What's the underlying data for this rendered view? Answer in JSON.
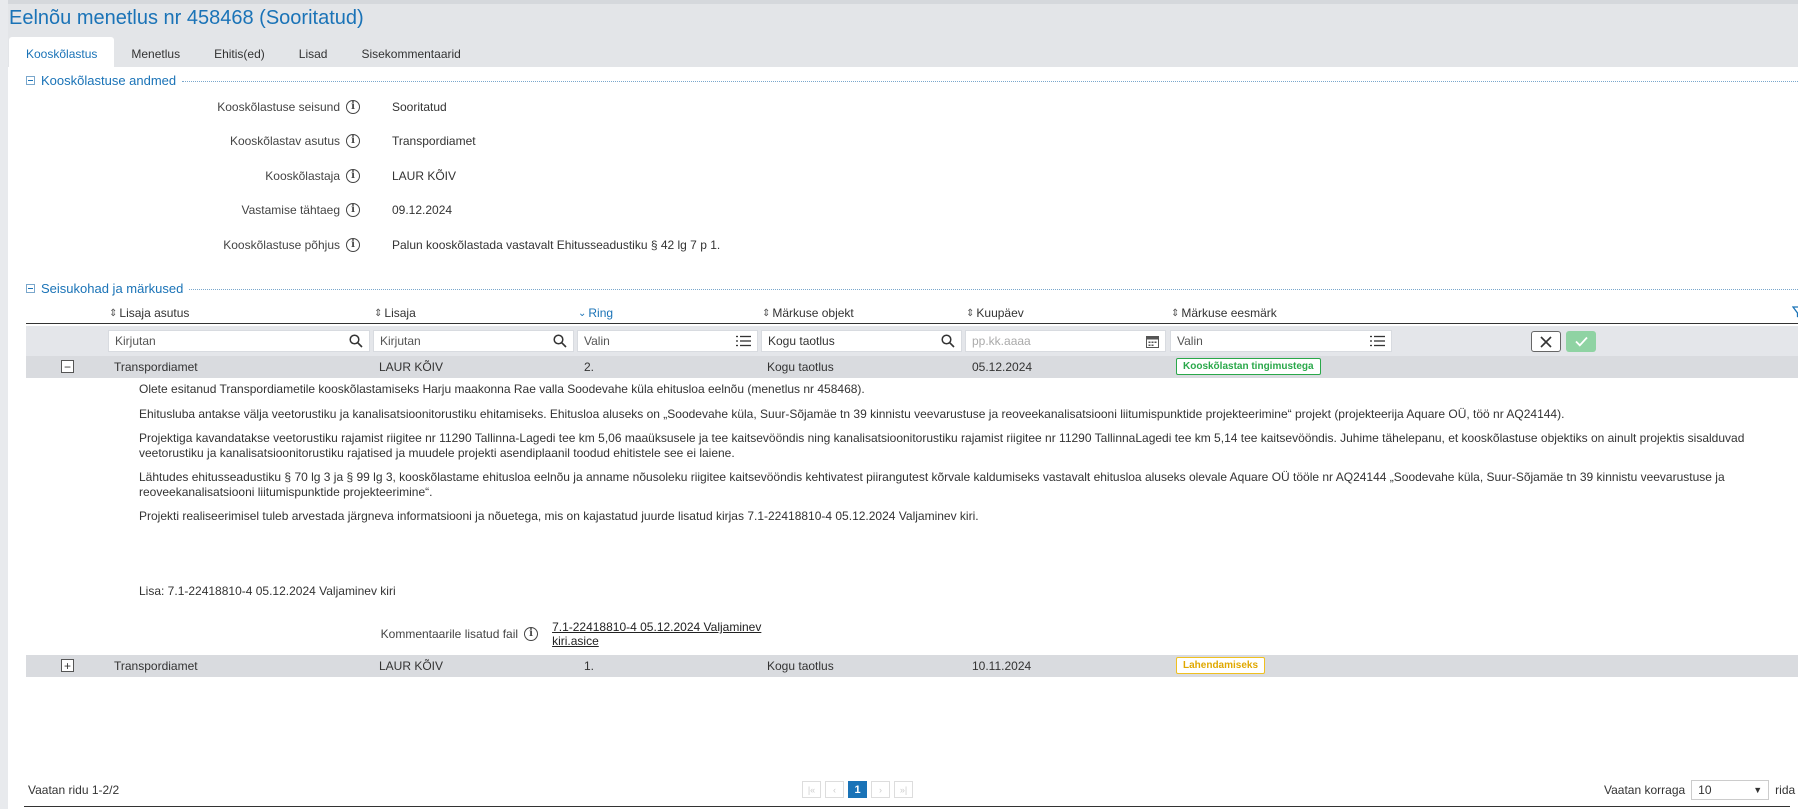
{
  "header": {
    "title": "Eelnõu menetlus nr 458468 (Sooritatud)",
    "tabs": [
      "Kooskõlastus",
      "Menetlus",
      "Ehitis(ed)",
      "Lisad",
      "Sisekommentaarid"
    ]
  },
  "section1": {
    "title": "Kooskõlastuse andmed",
    "fields": [
      {
        "label": "Kooskõlastuse seisund",
        "value": "Sooritatud"
      },
      {
        "label": "Kooskõlastav asutus",
        "value": "Transpordiamet"
      },
      {
        "label": "Kooskõlastaja",
        "value": "LAUR KÕIV"
      },
      {
        "label": "Vastamise tähtaeg",
        "value": "09.12.2024"
      },
      {
        "label": "Kooskõlastuse põhjus",
        "value": "Palun kooskõlastada vastavalt Ehitusseadustiku § 42 lg 7 p 1."
      }
    ]
  },
  "section2": {
    "title": "Seisukohad ja märkused",
    "columns": [
      "Lisaja asutus",
      "Lisaja",
      "Ring",
      "Märkuse objekt",
      "Kuupäev",
      "Märkuse eesmärk"
    ],
    "filters": {
      "asutus": "Kirjutan",
      "lisaja": "Kirjutan",
      "ring": "Valin",
      "objekt": "Kogu taotlus",
      "kuupaev": "pp.kk.aaaa",
      "eesmark": "Valin"
    },
    "rows": [
      {
        "toggle": "−",
        "asutus": "Transpordiamet",
        "lisaja": "LAUR KÕIV",
        "ring": "2.",
        "objekt": "Kogu taotlus",
        "kuupaev": "05.12.2024",
        "eesmark": "Kooskõlastan tingimustega"
      },
      {
        "toggle": "+",
        "asutus": "Transpordiamet",
        "lisaja": "LAUR KÕIV",
        "ring": "1.",
        "objekt": "Kogu taotlus",
        "kuupaev": "10.11.2024",
        "eesmark": "Lahendamiseks"
      }
    ],
    "detail": {
      "p1": "Olete esitanud Transpordiametile kooskõlastamiseks Harju maakonna Rae valla Soodevahe küla ehitusloa eelnõu (menetlus nr 458468).",
      "p2": "Ehitusluba antakse välja veetorustiku ja kanalisatsioonitorustiku ehitamiseks. Ehitusloa aluseks on „Soodevahe küla, Suur-Sõjamäe tn 39 kinnistu veevarustuse ja reoveekanalisatsiooni liitumispunktide projekteerimine“ projekt (projekteerija Aquare OÜ, töö nr AQ24144).",
      "p3": "Projektiga kavandatakse veetorustiku rajamist riigitee nr 11290 Tallinna-Lagedi tee km 5,06 maaüksusele ja tee kaitsevööndis ning kanalisatsioonitorustiku rajamist riigitee nr 11290 TallinnaLagedi tee km 5,14 tee kaitsevööndis. Juhime tähelepanu, et kooskõlastuse objektiks on ainult projektis sisalduvad veetorustiku ja kanalisatsioonitorustiku rajatised ja muudele projekti asendiplaanil toodud ehitistele see ei laiene.",
      "p4": "Lähtudes ehitusseadustiku § 70 lg 3 ja § 99 lg 3, kooskõlastame ehitusloa eelnõu ja anname nõusoleku riigitee kaitsevööndis kehtivatest piirangutest kõrvale kaldumiseks vastavalt ehitusloa aluseks olevale Aquare OÜ tööle nr AQ24144 „Soodevahe küla, Suur-Sõjamäe tn 39 kinnistu veevarustuse ja reoveekanalisatsiooni liitumispunktide projekteerimine“.",
      "p5": "Projekti realiseerimisel tuleb arvestada järgneva informatsiooni ja nõuetega, mis on kajastatud juurde lisatud kirjas 7.1-22418810-4 05.12.2024 Valjaminev kiri.",
      "lisa": "Lisa: 7.1-22418810-4 05.12.2024 Valjaminev kiri",
      "attachment_label": "Kommentaarile lisatud fail",
      "attachment_link": "7.1-22418810-4 05.12.2024 Valjaminev kiri.asice"
    }
  },
  "footer": {
    "rows_info": "Vaatan ridu 1-2/2",
    "page": "1",
    "per_page_label": "Vaatan korraga",
    "per_page_value": "10",
    "per_page_suffix": "rida"
  },
  "colors": {
    "accent": "#1a73b7",
    "green_badge": "#2aa84a",
    "yellow_badge": "#f0c020"
  }
}
